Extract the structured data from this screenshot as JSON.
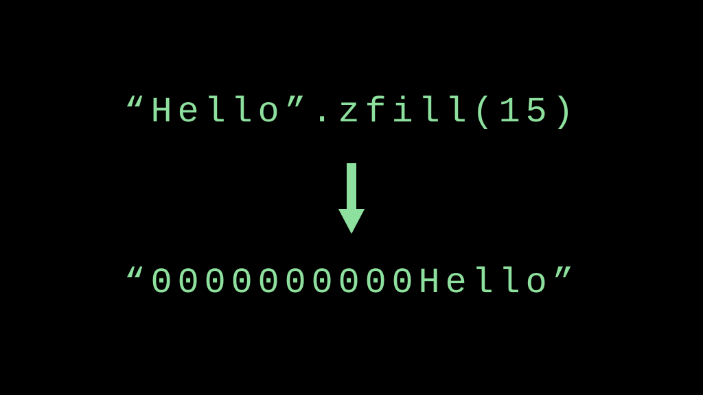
{
  "code_example": {
    "input": "“Hello”.zfill(15)",
    "output": "“0000000000Hello”"
  },
  "colors": {
    "background": "#000000",
    "text": "#8de09d",
    "arrow": "#8de09d"
  }
}
